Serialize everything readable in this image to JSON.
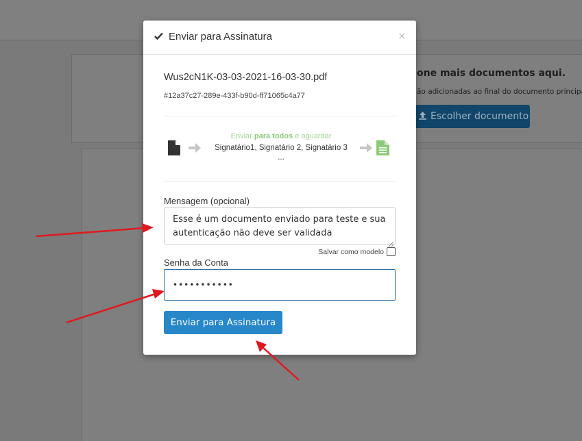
{
  "background": {
    "heading": "one mais documentos aqui.",
    "subtext": "ão adicionadas ao final do documento principal",
    "choose_button": "Escolher documento"
  },
  "modal": {
    "title": "Enviar para Assinatura",
    "close": "×",
    "filename": "Wus2cN1K-03-03-2021-16-03-30.pdf",
    "hash": "#12a37c27-289e-433f-b90d-ff71065c4a77",
    "flow": {
      "pre": "Enviar ",
      "bold": "para todos",
      "post": " e aguardar",
      "signers": "Signatário1, Signatário 2, Signatário 3",
      "ellipsis": "..."
    },
    "message_label": "Mensagem (opcional)",
    "message_value": "Esse é um documento enviado para teste e sua autenticação não deve ser validada",
    "save_as_model": "Salvar como modelo",
    "password_label": "Senha da Conta",
    "password_value": "•••••••••••",
    "submit_label": "Enviar para Assinatura"
  },
  "colors": {
    "primary": "#2787c9",
    "flow_green": "#8bcb77",
    "annotation_arrow": "#e0191f"
  }
}
